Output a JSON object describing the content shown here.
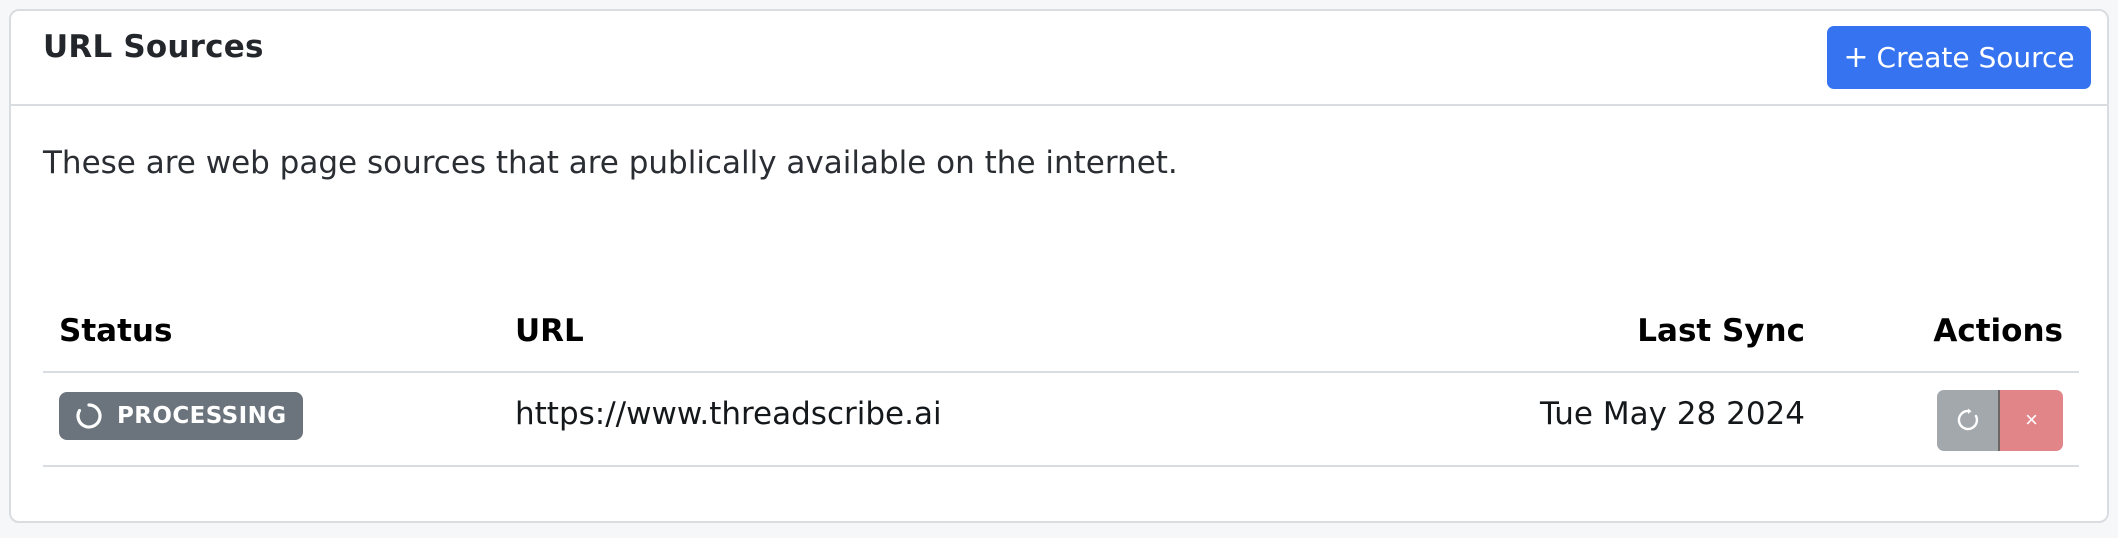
{
  "card": {
    "title": "URL Sources",
    "create_button_plus": "+",
    "create_button_label": "Create Source",
    "description": "These are web page sources that are publically available on the internet."
  },
  "table": {
    "headers": {
      "status": "Status",
      "url": "URL",
      "last_sync": "Last Sync",
      "actions": "Actions"
    },
    "rows": [
      {
        "status": "PROCESSING",
        "url": "https://www.threadscribe.ai",
        "last_sync": "Tue May 28 2024",
        "delete_glyph": "×"
      }
    ]
  },
  "icons": {
    "status_spinner": "spinner-icon",
    "refresh": "refresh-icon",
    "delete": "close-icon"
  },
  "colors": {
    "primary": "#3573f0",
    "badge": "#6b747d",
    "refresh_button": "#a3a8ad",
    "delete_button": "#e18588",
    "border": "#d9dce1"
  }
}
